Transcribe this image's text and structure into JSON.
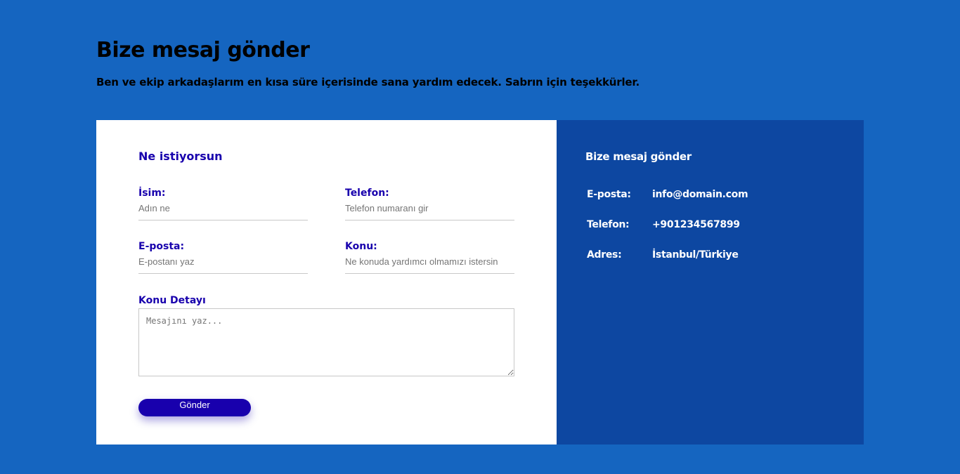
{
  "header": {
    "title": "Bize mesaj gönder",
    "subtitle": "Ben ve ekip arkadaşlarım en kısa süre içerisinde sana yardım edecek. Sabrın için teşekkürler."
  },
  "form": {
    "title": "Ne istiyorsun",
    "name_label": "İsim:",
    "name_placeholder": "Adın ne",
    "phone_label": "Telefon:",
    "phone_placeholder": "Telefon numaranı gir",
    "email_label": "E-posta:",
    "email_placeholder": "E-postanı yaz",
    "subject_label": "Konu:",
    "subject_placeholder": "Ne konuda yardımcı olmamızı istersin",
    "detail_label": "Konu Detayı",
    "detail_placeholder": "Mesajını yaz...",
    "submit_label": "Gönder"
  },
  "info": {
    "title": "Bize mesaj gönder",
    "rows": [
      {
        "key": "E-posta:",
        "value": "info@domain.com"
      },
      {
        "key": "Telefon:",
        "value": "+901234567899"
      },
      {
        "key": "Adres:",
        "value": "İstanbul/Türkiye"
      }
    ]
  },
  "colors": {
    "page_background": "#1565c0",
    "info_panel": "#0d47a1",
    "accent": "#1800ad"
  }
}
